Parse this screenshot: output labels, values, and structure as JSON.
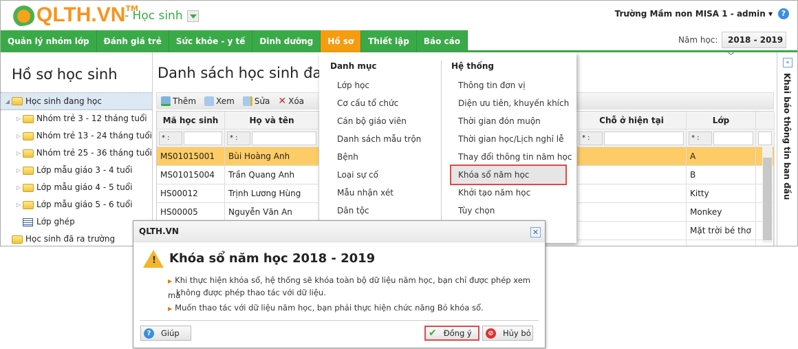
{
  "header": {
    "logo_text": "QLTH.VN",
    "logo_tm": "TM",
    "module": "- Học sinh",
    "user": "Trường Mầm non MISA 1 - admin ▾",
    "help": "?"
  },
  "nav": {
    "tabs": [
      "Quản lý nhóm lớp",
      "Đánh giá trẻ",
      "Sức khỏe - y tế",
      "Dinh dưỡng",
      "Hồ sơ",
      "Thiết lập",
      "Báo cáo"
    ],
    "active": "Hồ sơ",
    "year_label": "Năm học:",
    "year_value": "2018 - 2019"
  },
  "colors": {
    "nav_green": "#3aaa48",
    "active_orange": "#f59c11",
    "selected_row": "#fdcc66",
    "highlight_border": "#e04848"
  },
  "left": {
    "title": "Hồ sơ học sinh",
    "tree": [
      {
        "label": "Học sinh đang học",
        "level": 0,
        "expanded": true,
        "selected": true,
        "icon": "folder-icon"
      },
      {
        "label": "Nhóm trẻ 3 - 12 tháng tuổi",
        "level": 1,
        "icon": "folder-icon"
      },
      {
        "label": "Nhóm trẻ 13 - 24 tháng tuổi",
        "level": 1,
        "icon": "folder-icon"
      },
      {
        "label": "Nhóm trẻ 25 - 36 tháng tuổi",
        "level": 1,
        "icon": "folder-icon"
      },
      {
        "label": "Lớp mẫu giáo 3 - 4 tuổi",
        "level": 1,
        "icon": "folder-icon"
      },
      {
        "label": "Lớp mẫu giáo 4 - 5 tuổi",
        "level": 1,
        "icon": "folder-icon"
      },
      {
        "label": "Lớp mẫu giáo 5 - 6 tuổi",
        "level": 1,
        "icon": "folder-icon"
      },
      {
        "label": "Lớp ghép",
        "level": 1,
        "icon": "list-icon"
      },
      {
        "label": "Học sinh đã ra trường",
        "level": 0,
        "icon": "folder-icon"
      }
    ]
  },
  "main": {
    "title": "Danh sách học sinh đang",
    "toolbar": [
      "Thêm",
      "Xem",
      "Sửa",
      "Xóa"
    ],
    "filter_op": "* :",
    "columns": [
      "Mã học sinh",
      "Họ và tên",
      "Chỗ ở hiện tại",
      "Lớp"
    ],
    "rows": [
      [
        "MS01015001",
        "Bùi Hoàng Anh",
        "",
        "A"
      ],
      [
        "MS01015004",
        "Trần Quang Anh",
        "",
        "B"
      ],
      [
        "HS00012",
        "Trịnh Lương Hùng",
        "",
        "Kitty"
      ],
      [
        "HS00005",
        "Nguyễn Văn An",
        "",
        "Monkey"
      ],
      [
        "",
        "",
        "",
        "Mặt trời bé thơ"
      ]
    ]
  },
  "side": {
    "label": "Khai báo thông tin ban đầu",
    "collapse": "«"
  },
  "menu": {
    "col1_title": "Danh mục",
    "col1": [
      "Lớp học",
      "Cơ cấu tổ chức",
      "Cán bộ giáo viên",
      "Danh sách mẫu trộn",
      "Bệnh",
      "Loại sự cố",
      "Mẫu nhận xét",
      "Dân tộc"
    ],
    "col2_title": "Hệ thống",
    "col2": [
      "Thông tin đơn vị",
      "Diện ưu tiên, khuyến khích",
      "Thời gian đón muộn",
      "Thời gian học/Lịch nghỉ lễ",
      "Thay đổi thông tin năm học",
      "Khóa sổ năm học",
      "Khởi tạo năm học",
      "Tùy chọn"
    ],
    "highlighted": "Khóa sổ năm học"
  },
  "dialog": {
    "title": "QLTH.VN",
    "heading": "Khóa sổ năm học 2018 - 2019",
    "line1a": "Khi thực hiện khóa sổ, hệ thống sẽ khóa toàn bộ dữ liệu năm học, bạn chỉ được phép xem mà",
    "line1b": "không được phép thao tác với dữ liệu.",
    "line2": "Muốn thao tác với dữ liệu năm học, bạn phải thực hiện chức năng Bỏ khóa sổ.",
    "help": "Giúp",
    "ok": "Đồng ý",
    "cancel": "Hủy bỏ"
  }
}
